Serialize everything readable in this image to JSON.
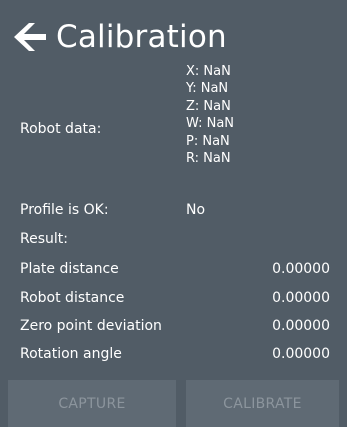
{
  "header": {
    "title": "Calibration",
    "back_icon": "arrow-left-icon"
  },
  "robot_data": {
    "label": "Robot data:",
    "values": [
      "X: NaN",
      "Y: NaN",
      "Z: NaN",
      "W: NaN",
      "P: NaN",
      "R: NaN"
    ]
  },
  "profile": {
    "label": "Profile is OK:",
    "value": "No"
  },
  "result": {
    "label": "Result:"
  },
  "metrics": [
    {
      "label": "Plate distance",
      "value": "0.00000"
    },
    {
      "label": "Robot distance",
      "value": "0.00000"
    },
    {
      "label": "Zero point deviation",
      "value": "0.00000"
    },
    {
      "label": "Rotation angle",
      "value": "0.00000"
    }
  ],
  "buttons": {
    "capture": "CAPTURE",
    "calibrate": "CALIBRATE"
  },
  "colors": {
    "background": "#515c66",
    "button_disabled": "#5f6a74",
    "text": "#ffffff",
    "disabled_text": "#8c959d"
  }
}
